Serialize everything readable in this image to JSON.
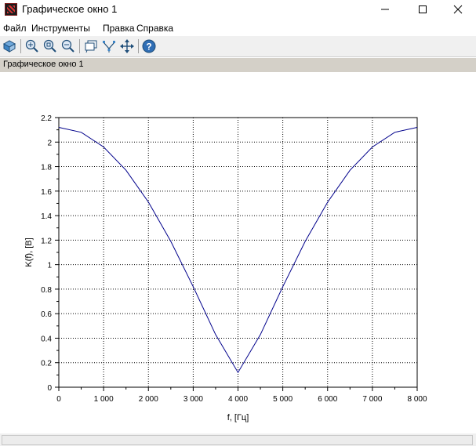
{
  "window": {
    "title": "Графическое окно 1"
  },
  "menu": {
    "items": [
      "Файл",
      "Инструменты",
      "Правка",
      "Справка"
    ]
  },
  "toolbar": {
    "icons": [
      "rotate-3d-icon",
      "zoom-in-icon",
      "zoom-region-icon",
      "zoom-out-icon",
      "datatip-icon",
      "datatip-edit-icon",
      "pan-icon",
      "help-icon"
    ]
  },
  "figure": {
    "label": "Графическое окно 1"
  },
  "chart_data": {
    "type": "line",
    "xlabel": "f, [Гц]",
    "ylabel": "K(f), [B]",
    "xlim": [
      0,
      8000
    ],
    "ylim": [
      0,
      2.2
    ],
    "xticks": [
      0,
      1000,
      2000,
      3000,
      4000,
      5000,
      6000,
      7000,
      8000
    ],
    "xtick_labels": [
      "0",
      "1 000",
      "2 000",
      "3 000",
      "4 000",
      "5 000",
      "6 000",
      "7 000",
      "8 000"
    ],
    "yticks": [
      0,
      0.2,
      0.4,
      0.6,
      0.8,
      1,
      1.2,
      1.4,
      1.6,
      1.8,
      2,
      2.2
    ],
    "ytick_labels": [
      "0",
      "0.2",
      "0.4",
      "0.6",
      "0.8",
      "1",
      "1.2",
      "1.4",
      "1.6",
      "1.8",
      "2",
      "2.2"
    ],
    "grid": true,
    "series": [
      {
        "color": "#00008b",
        "x": [
          0,
          500,
          1000,
          1500,
          2000,
          2500,
          3000,
          3500,
          4000,
          4500,
          5000,
          5500,
          6000,
          6500,
          7000,
          7500,
          8000
        ],
        "y": [
          2.12,
          2.08,
          1.96,
          1.77,
          1.51,
          1.19,
          0.82,
          0.43,
          0.12,
          0.43,
          0.82,
          1.19,
          1.51,
          1.77,
          1.96,
          2.08,
          2.12
        ]
      }
    ]
  }
}
